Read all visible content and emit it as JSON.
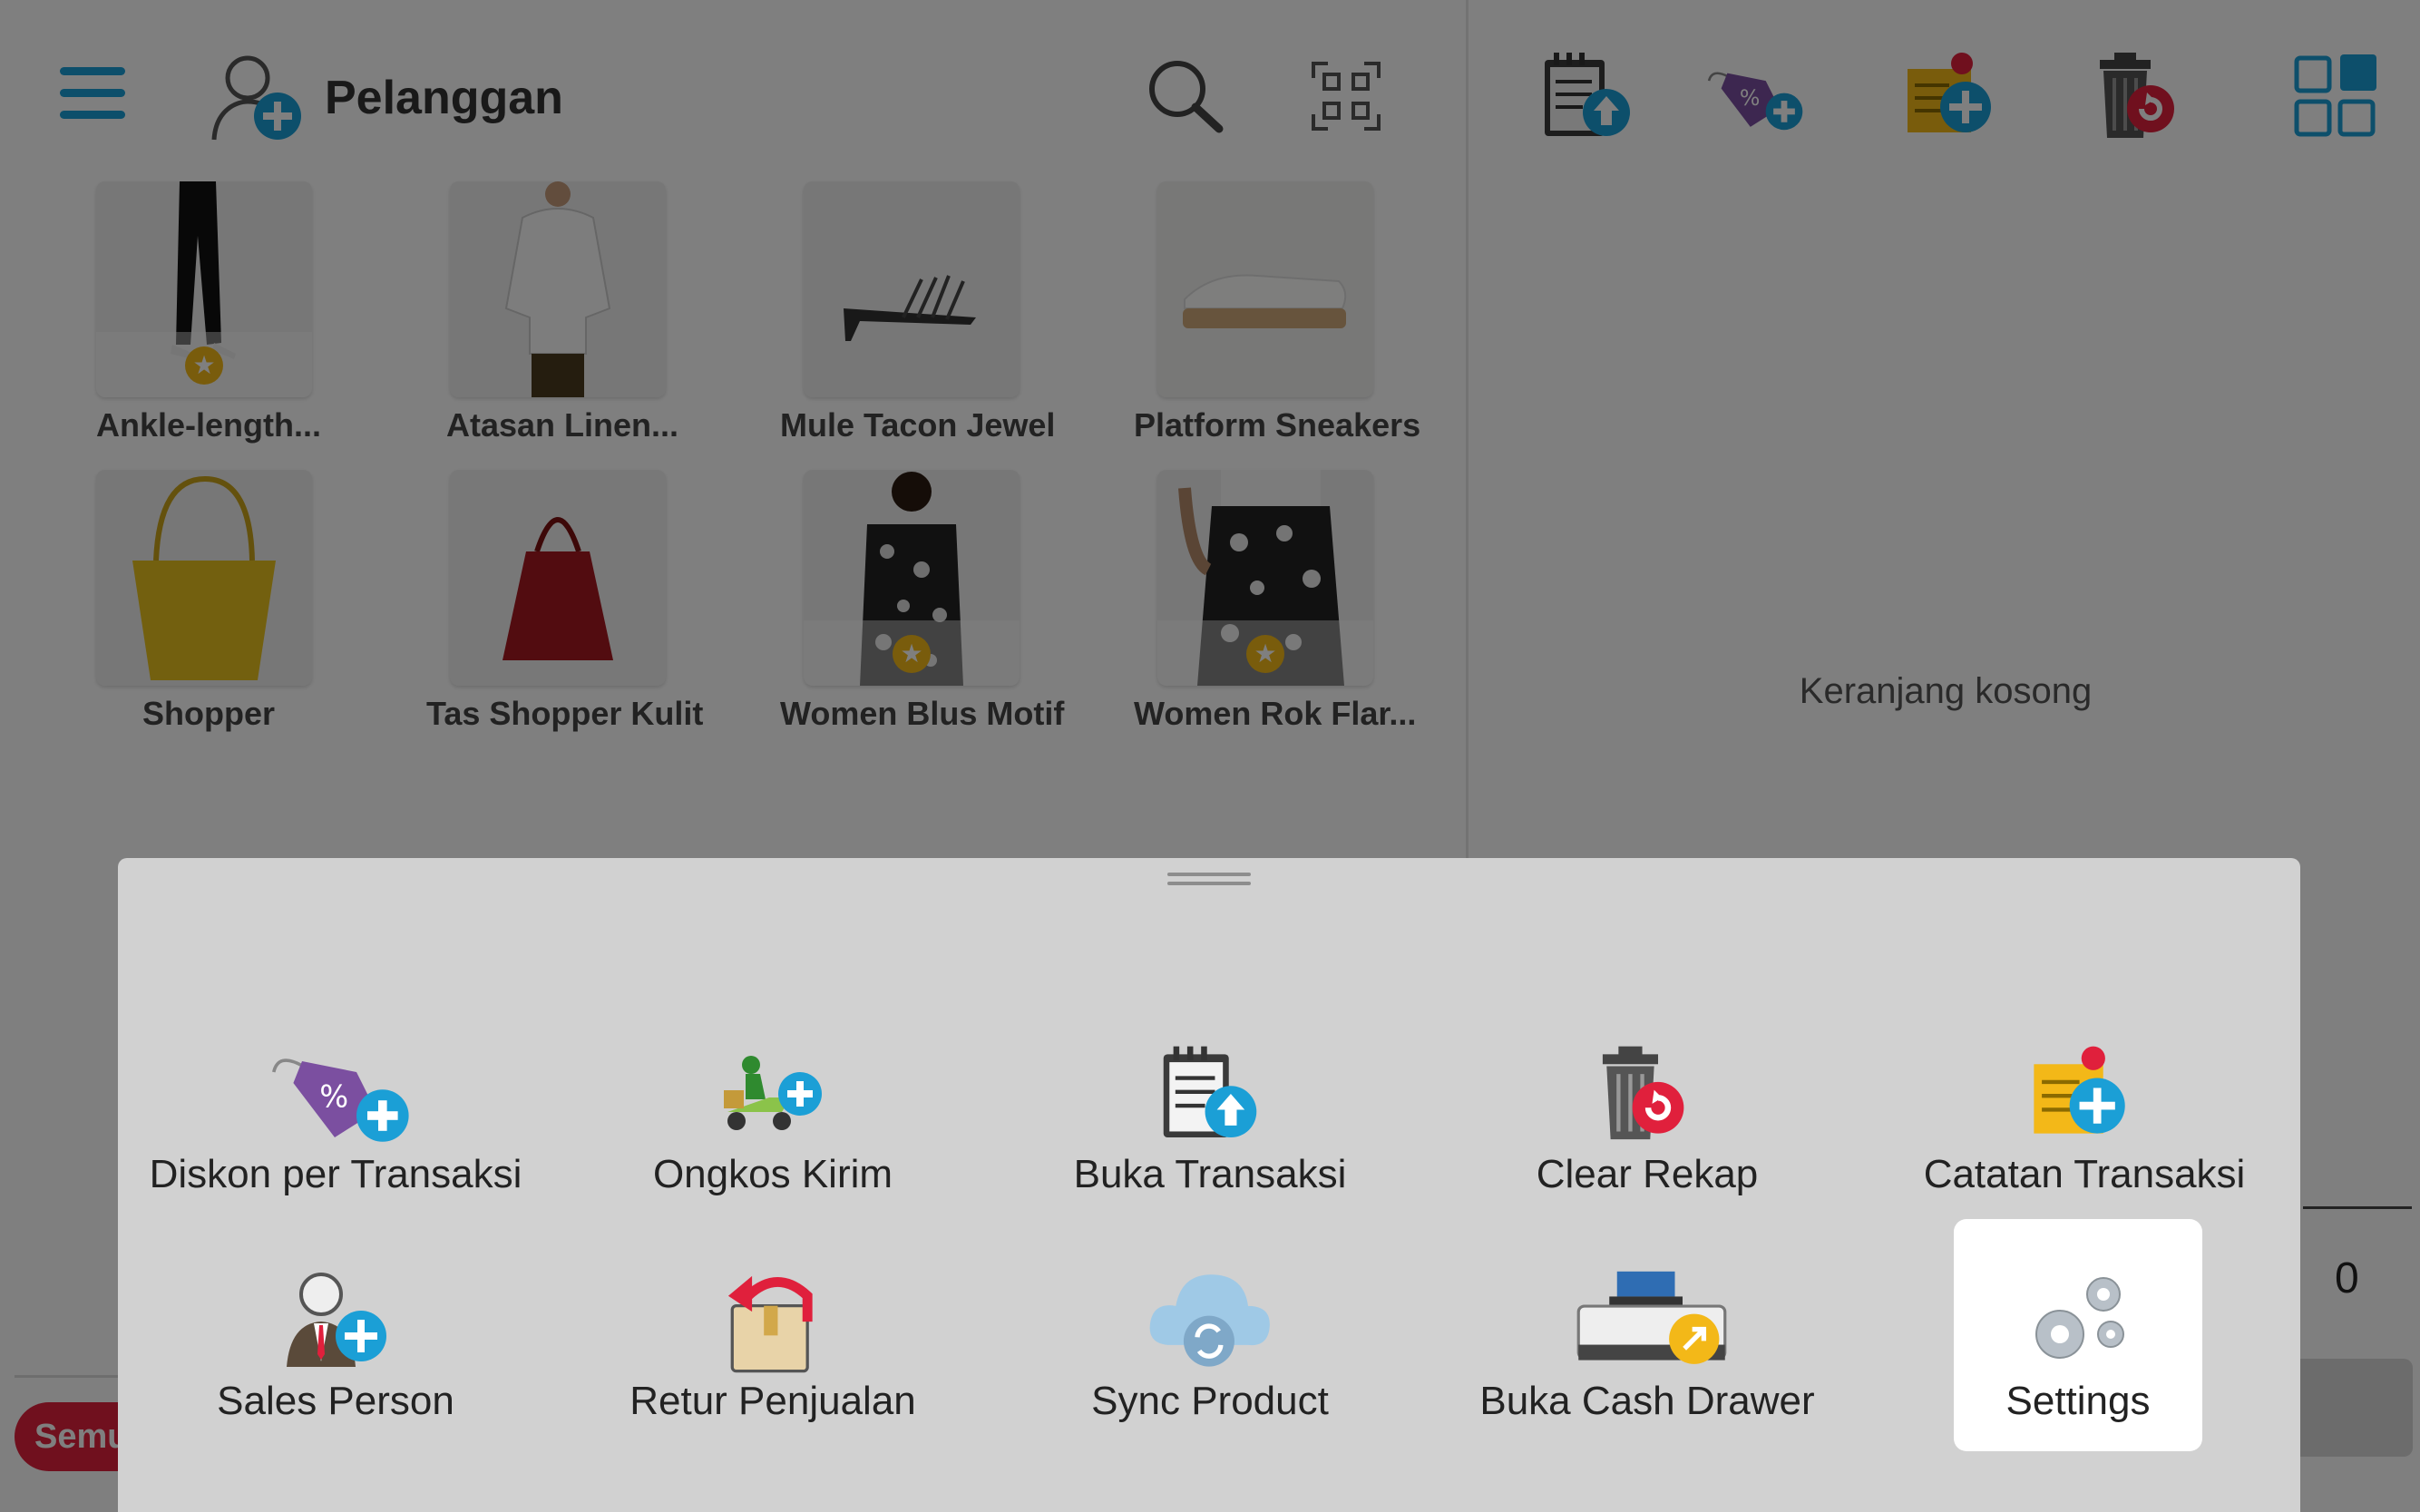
{
  "header": {
    "customer_label": "Pelanggan"
  },
  "products": [
    {
      "name": "Ankle-length...",
      "starred": true
    },
    {
      "name": "Atasan Linen...",
      "starred": false
    },
    {
      "name": "Mule Tacon Jewel",
      "starred": false
    },
    {
      "name": "Platform Sneakers",
      "starred": false
    },
    {
      "name": "Shopper",
      "starred": false
    },
    {
      "name": "Tas Shopper Kulit",
      "starred": false
    },
    {
      "name": "Women Blus Motif",
      "starred": true
    },
    {
      "name": "Women Rok Flar...",
      "starred": true
    }
  ],
  "cart": {
    "empty_text": "Keranjang kosong",
    "total_value": "0"
  },
  "filter": {
    "semua_label": "Semu"
  },
  "menu": {
    "items": [
      {
        "label": "Diskon per Transaksi",
        "icon": "discount-tag-icon"
      },
      {
        "label": "Ongkos Kirim",
        "icon": "delivery-scooter-icon"
      },
      {
        "label": "Buka Transaksi",
        "icon": "open-transaction-icon"
      },
      {
        "label": "Clear Rekap",
        "icon": "trash-reset-icon"
      },
      {
        "label": "Catatan Transaksi",
        "icon": "transaction-note-icon"
      },
      {
        "label": "Sales Person",
        "icon": "sales-person-icon"
      },
      {
        "label": "Retur Penjualan",
        "icon": "sales-return-icon"
      },
      {
        "label": "Sync Product",
        "icon": "cloud-sync-icon"
      },
      {
        "label": "Buka Cash Drawer",
        "icon": "cash-drawer-icon"
      },
      {
        "label": "Settings",
        "icon": "settings-gears-icon",
        "selected": true
      }
    ]
  },
  "colors": {
    "accent": "#1b9fd6",
    "red": "#e0203c",
    "star": "#f3b818",
    "sheet": "#d1d1d1"
  }
}
